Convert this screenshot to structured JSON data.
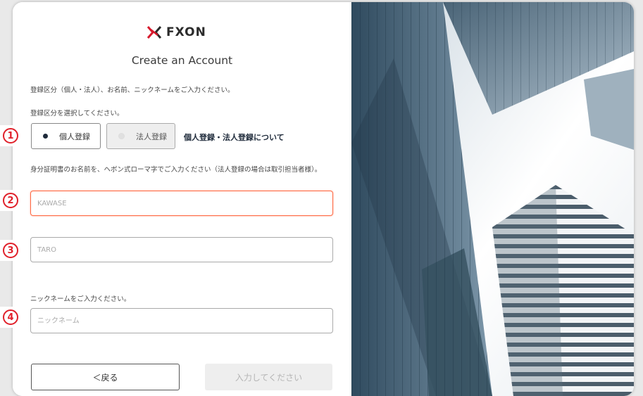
{
  "logo": {
    "text": "FXON"
  },
  "title": "Create an Account",
  "intro_text": "登録区分（個人・法人）、お名前、ニックネームをご入力ください。",
  "category": {
    "prompt": "登録区分を選択してください。",
    "options": [
      "個人登録",
      "法人登録"
    ],
    "selected": "個人登録",
    "about_link": "個人登録・法人登録について"
  },
  "name_instruction": "身分証明書のお名前を、ヘボン式ローマ字でご入力ください（法人登録の場合は取引担当者様）。",
  "last_name": {
    "placeholder": "KAWASE"
  },
  "first_name": {
    "placeholder": "TARO"
  },
  "nickname": {
    "prompt": "ニックネームをご入力ください。",
    "placeholder": "ニックネーム"
  },
  "buttons": {
    "back": "＜戻る",
    "submit": "入力してください"
  },
  "annotations": [
    "1",
    "2",
    "3",
    "4"
  ],
  "colors": {
    "accent": "#ff6a45",
    "badge": "#e0202a",
    "logo_x": "#d7192c"
  }
}
